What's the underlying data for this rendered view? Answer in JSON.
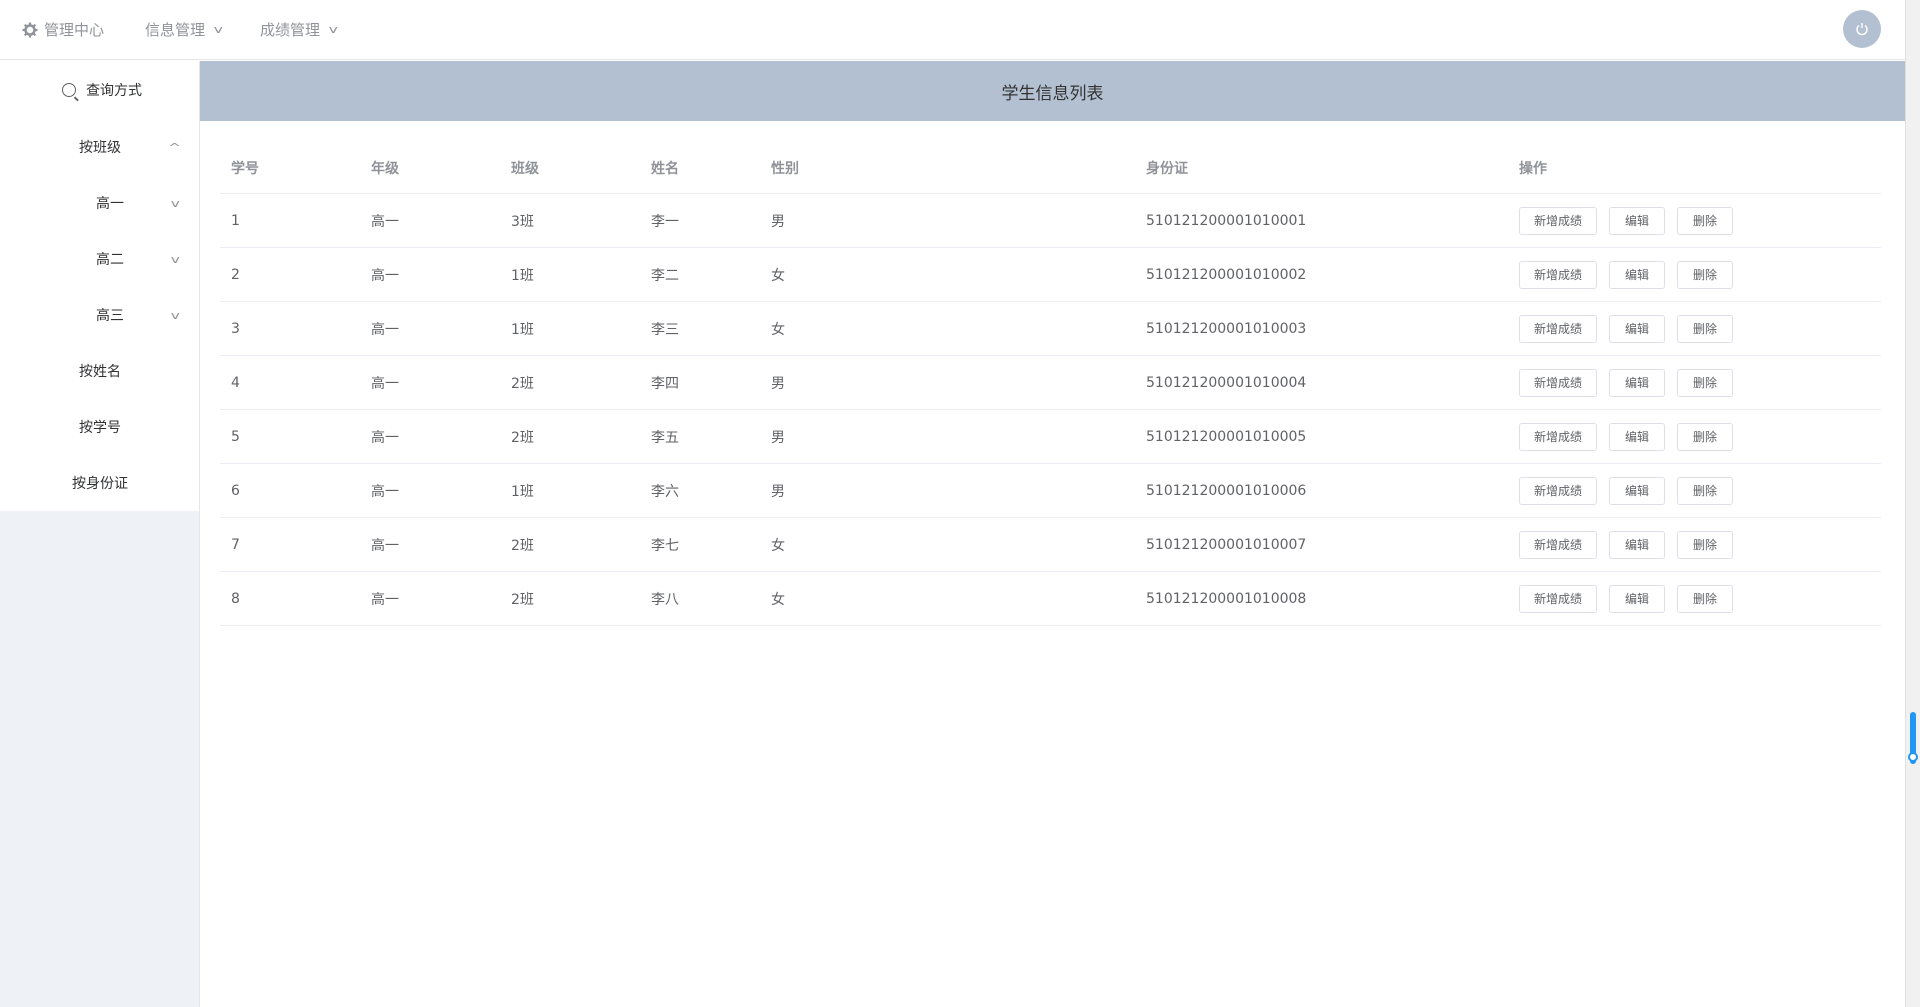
{
  "nav": {
    "home": "管理中心",
    "info": "信息管理",
    "score": "成绩管理"
  },
  "sidebar": {
    "search_label": "查询方式",
    "by_class": "按班级",
    "grades": [
      "高一",
      "高二",
      "高三"
    ],
    "by_name": "按姓名",
    "by_id": "按学号",
    "by_idcard": "按身份证"
  },
  "main": {
    "title": "学生信息列表",
    "columns": [
      "学号",
      "年级",
      "班级",
      "姓名",
      "性别",
      "身份证",
      "操作"
    ],
    "rows": [
      [
        "1",
        "高一",
        "3班",
        "李一",
        "男",
        "510121200001010001"
      ],
      [
        "2",
        "高一",
        "1班",
        "李二",
        "女",
        "510121200001010002"
      ],
      [
        "3",
        "高一",
        "1班",
        "李三",
        "女",
        "510121200001010003"
      ],
      [
        "4",
        "高一",
        "2班",
        "李四",
        "男",
        "510121200001010004"
      ],
      [
        "5",
        "高一",
        "2班",
        "李五",
        "男",
        "510121200001010005"
      ],
      [
        "6",
        "高一",
        "1班",
        "李六",
        "男",
        "510121200001010006"
      ],
      [
        "7",
        "高一",
        "2班",
        "李七",
        "女",
        "510121200001010007"
      ],
      [
        "8",
        "高一",
        "2班",
        "李八",
        "女",
        "510121200001010008"
      ]
    ],
    "actions": {
      "add_score": "新增成绩",
      "edit": "编辑",
      "delete": "删除"
    }
  },
  "icons": {
    "home": "gear-icon",
    "power": "power-icon",
    "search": "search-icon"
  },
  "colors": {
    "header_bg": "#b3c0d1",
    "sidebar_bg": "#eef1f6",
    "scroll_accent": "#2196f3"
  }
}
